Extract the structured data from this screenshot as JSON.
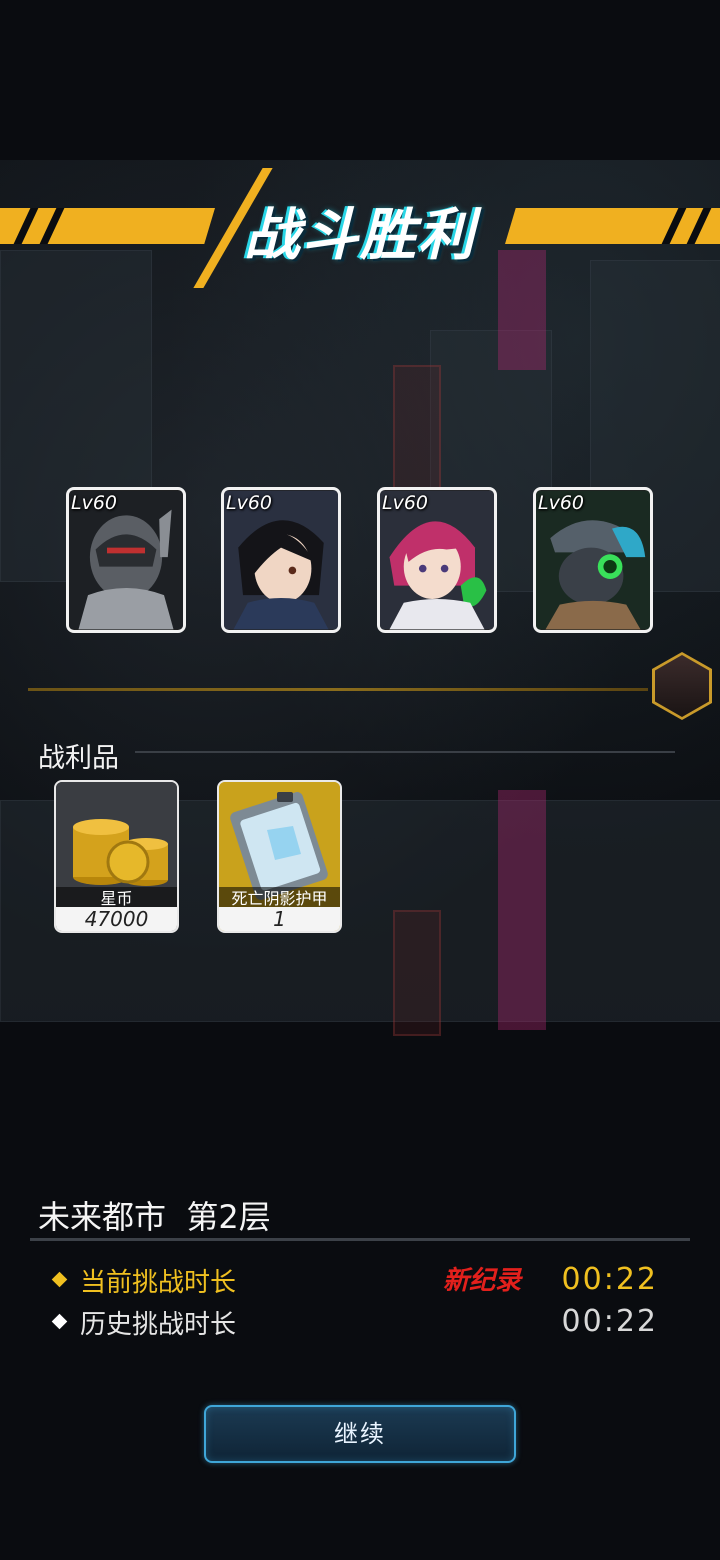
{
  "banner": {
    "title": "战斗胜利"
  },
  "heroes": [
    {
      "level": "Lv60",
      "name": "robot-hero"
    },
    {
      "level": "Lv60",
      "name": "dark-hair-hero"
    },
    {
      "level": "Lv60",
      "name": "pink-hair-hero"
    },
    {
      "level": "Lv60",
      "name": "goggles-hero"
    }
  ],
  "loot": {
    "title": "战利品",
    "items": [
      {
        "name": "星币",
        "qty": "47000"
      },
      {
        "name": "死亡阴影护甲",
        "qty": "1"
      }
    ]
  },
  "stage": {
    "name": "未来都市  第2层",
    "current_label": "当前挑战时长",
    "current_value": "00:22",
    "record_tag": "新纪录",
    "history_label": "历史挑战时长",
    "history_value": "00:22"
  },
  "continue_label": "继续",
  "colors": {
    "accent": "#f0b020",
    "record": "#e3201c",
    "current": "#f0c020",
    "button_border": "#3fa6d8"
  }
}
